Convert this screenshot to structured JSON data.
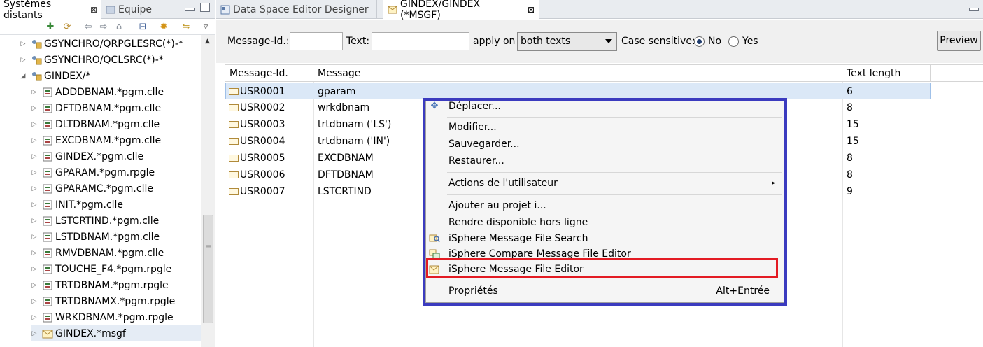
{
  "left_panel": {
    "tabs": [
      {
        "label": "Systèmes distants",
        "close": "⊠"
      },
      {
        "label": "Equipe"
      }
    ],
    "tree": [
      {
        "label": "GSYNCHRO/QRPGLESRC(*)-*",
        "expanded": false
      },
      {
        "label": "GSYNCHRO/QCLSRC(*)-*",
        "expanded": false
      },
      {
        "label": "GINDEX/*",
        "expanded": true
      },
      {
        "label": "ADDDBNAM.*pgm.clle"
      },
      {
        "label": "DFTDBNAM.*pgm.clle"
      },
      {
        "label": "DLTDBNAM.*pgm.clle"
      },
      {
        "label": "EXCDBNAM.*pgm.clle"
      },
      {
        "label": "GINDEX.*pgm.clle"
      },
      {
        "label": "GPARAM.*pgm.rpgle"
      },
      {
        "label": "GPARAMC.*pgm.clle"
      },
      {
        "label": "INIT.*pgm.clle"
      },
      {
        "label": "LSTCRTIND.*pgm.clle"
      },
      {
        "label": "LSTDBNAM.*pgm.clle"
      },
      {
        "label": "RMVDBNAM.*pgm.clle"
      },
      {
        "label": "TOUCHE_F4.*pgm.rpgle"
      },
      {
        "label": "TRTDBNAM.*pgm.rpgle"
      },
      {
        "label": "TRTDBNAMX.*pgm.rpgle"
      },
      {
        "label": "WRKDBNAM.*pgm.rpgle"
      },
      {
        "label": "GINDEX.*msgf",
        "selected": true
      }
    ]
  },
  "editor": {
    "tabs": [
      {
        "label": "Data Space Editor Designer"
      },
      {
        "label": "GINDEX/GINDEX (*MSGF)",
        "close": "⊠"
      }
    ],
    "filter": {
      "message_id_label": "Message-Id.:",
      "message_id_value": "",
      "text_label": "Text:",
      "text_value": "",
      "apply_on_label": "apply on",
      "apply_on_value": "both texts",
      "case_label": "Case sensitive:",
      "case_no": "No",
      "case_yes": "Yes",
      "case_selected": "No",
      "preview_button": "Preview"
    },
    "table": {
      "columns": [
        "Message-Id.",
        "Message",
        "Text length"
      ],
      "rows": [
        {
          "id": "USR0001",
          "message": "gparam",
          "length": "6",
          "selected": true
        },
        {
          "id": "USR0002",
          "message": "wrkdbnam",
          "length": "8"
        },
        {
          "id": "USR0003",
          "message": "trtdbnam ('LS')",
          "length": "15"
        },
        {
          "id": "USR0004",
          "message": "trtdbnam ('IN')",
          "length": "15"
        },
        {
          "id": "USR0005",
          "message": "EXCDBNAM",
          "length": "8"
        },
        {
          "id": "USR0006",
          "message": "DFTDBNAM",
          "length": "8"
        },
        {
          "id": "USR0007",
          "message": "LSTCRTIND",
          "length": "9"
        }
      ]
    }
  },
  "context_menu": {
    "items": [
      {
        "label": "Déplacer...",
        "icon": "move-icon"
      },
      {
        "label": "Modifier..."
      },
      {
        "label": "Sauvegarder..."
      },
      {
        "label": "Restaurer..."
      },
      {
        "label": "Actions de l'utilisateur",
        "submenu": "▸"
      },
      {
        "label": "Ajouter au projet i..."
      },
      {
        "label": "Rendre disponible hors ligne"
      },
      {
        "label": "iSphere Message File Search",
        "icon": "isphere-search-icon"
      },
      {
        "label": "iSphere Compare Message File Editor",
        "icon": "isphere-compare-icon"
      },
      {
        "label": "iSphere Message File Editor",
        "icon": "isphere-editor-icon",
        "highlighted": true
      },
      {
        "label": "Propriétés",
        "shortcut": "Alt+Entrée"
      }
    ]
  },
  "colors": {
    "frame_blue": "#3b3bbf",
    "highlight_red": "#e31b23",
    "selection_blue": "#dbe8f7"
  }
}
